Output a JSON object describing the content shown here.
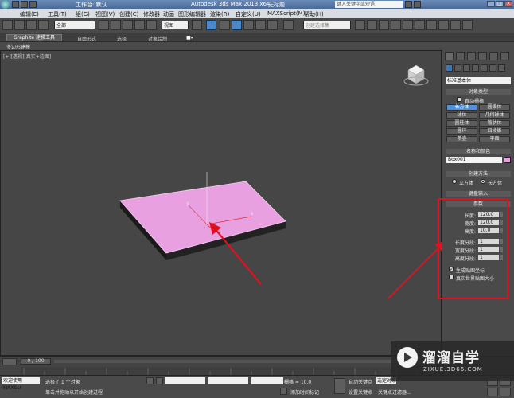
{
  "titlebar": {
    "workspace": "工作台: 默认",
    "app_title": "Autodesk 3ds Max  2013 x64",
    "doc_title": "无标题",
    "search_placeholder": "键入关键字或短语"
  },
  "menu": [
    "编辑(E)",
    "工具(T)",
    "组(G)",
    "视图(V)",
    "创建(C)",
    "修改器",
    "动画",
    "图形编辑器",
    "渲染(R)",
    "自定义(U)",
    "MAXScript(M)",
    "帮助(H)"
  ],
  "toolbar": {
    "filter_value": "全部",
    "refcoord_value": "视图",
    "named_sel_placeholder": "创建选择集"
  },
  "ribbon": {
    "tabs": [
      "Graphite 建模工具",
      "自由形式",
      "选择",
      "对象绘制"
    ],
    "subtitle": "多边形建模"
  },
  "viewport": {
    "label": "[+][透视][真实+边面]"
  },
  "cmdpanel": {
    "category": "标准基本体",
    "object_type_header": "对象类型",
    "autogrid_label": "自动栅格",
    "object_buttons": [
      "长方体",
      "圆锥体",
      "球体",
      "几何球体",
      "圆柱体",
      "管状体",
      "圆环",
      "四棱锥",
      "茶壶",
      "平面"
    ],
    "active_object": "长方体",
    "name_color_header": "名称和颜色",
    "object_name": "Box001",
    "object_color": "#e8a0e0",
    "creation_method_header": "创建方法",
    "creation_cube": "立方体",
    "creation_box": "长方体",
    "keyboard_entry_header": "键盘输入",
    "params_header": "参数",
    "params": [
      {
        "label": "长度:",
        "value": "120.0"
      },
      {
        "label": "宽度:",
        "value": "120.0"
      },
      {
        "label": "高度:",
        "value": "10.0"
      }
    ],
    "segs": [
      {
        "label": "长度分段:",
        "value": "1"
      },
      {
        "label": "宽度分段:",
        "value": "1"
      },
      {
        "label": "高度分段:",
        "value": "1"
      }
    ],
    "gen_mapping_label": "生成贴图坐标",
    "real_world_label": "真实世界贴图大小"
  },
  "timeline": {
    "slider_label": "0 / 100"
  },
  "statusbar": {
    "welcome": "欢迎使用 MAXScr",
    "selected_text": "选择了 1 个对象",
    "hint_text": "单击并拖动以开始创建过程",
    "grid_text": "栅格 = 10.0",
    "add_time_tag": "添加时间标记",
    "auto_key": "自动关键点",
    "set_key": "设置关键点",
    "key_filter": "关键点过滤器...",
    "selection_box": "选定对象"
  },
  "watermark": {
    "title": "溜溜自学",
    "url": "ZIXUE.3D66.COM"
  },
  "colors": {
    "box_top": "#e8a0e0",
    "annotation_red": "#e01020",
    "highlight_blue": "#5090d8"
  }
}
